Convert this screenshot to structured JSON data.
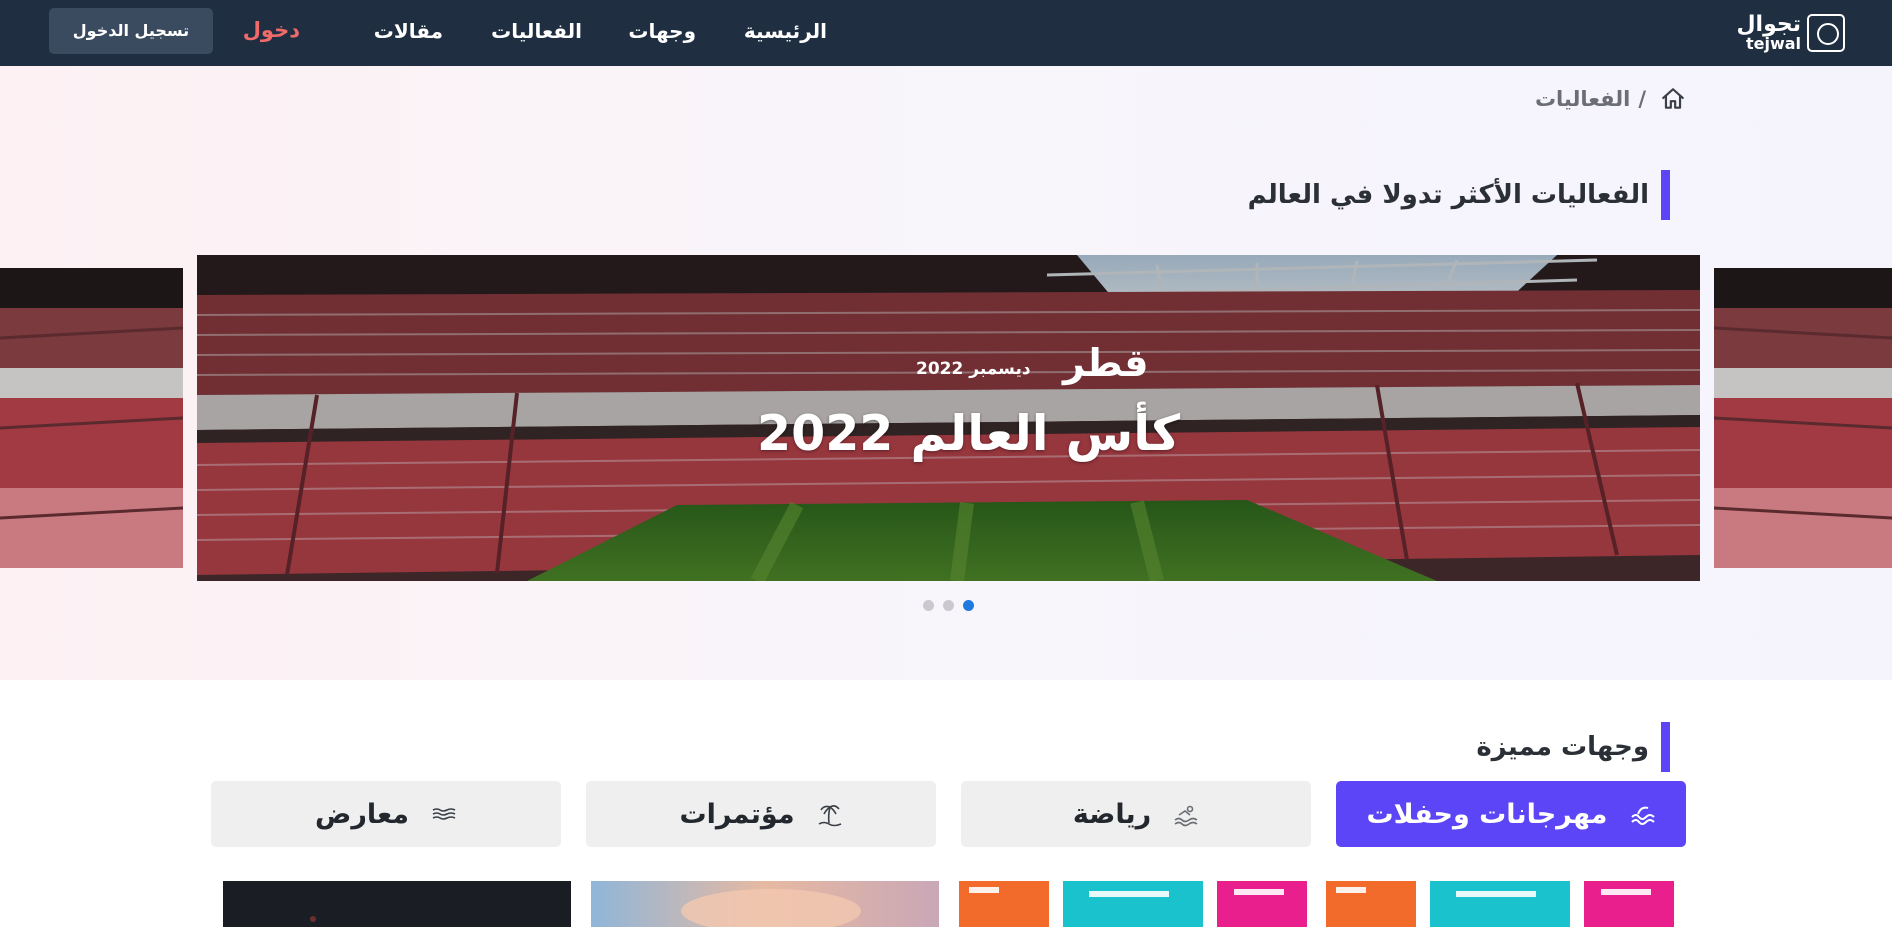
{
  "header": {
    "logo_ar": "تجوال",
    "logo_en": "tejwal",
    "nav": {
      "home": "الرئيسية",
      "destinations": "وجهات",
      "events": "الفعاليات",
      "articles": "مقالات"
    },
    "login": "دخول",
    "register": "تسجيل الدخول"
  },
  "breadcrumb": {
    "separator": "/",
    "current": "الفعاليات"
  },
  "trending": {
    "title": "الفعاليات الأكثر تدولا في العالم",
    "slide": {
      "country": "قطر",
      "date": "ديسمبر 2022",
      "title": "كأس العالم 2022"
    },
    "dots_count": 3,
    "active_dot": 3
  },
  "featured": {
    "title": "وجهات مميزة",
    "categories": [
      {
        "label": "مهرجانات وحفلات",
        "icon": "waves-icon",
        "active": true
      },
      {
        "label": "رياضة",
        "icon": "swimmer-icon",
        "active": false
      },
      {
        "label": "مؤتمرات",
        "icon": "island-icon",
        "active": false
      },
      {
        "label": "معارض",
        "icon": "water-lines-icon",
        "active": false
      }
    ]
  },
  "colors": {
    "navbar": "#1f2e41",
    "accent": "#5b45f6",
    "login": "#f06a6a",
    "active_dot": "#1f7ae0"
  }
}
